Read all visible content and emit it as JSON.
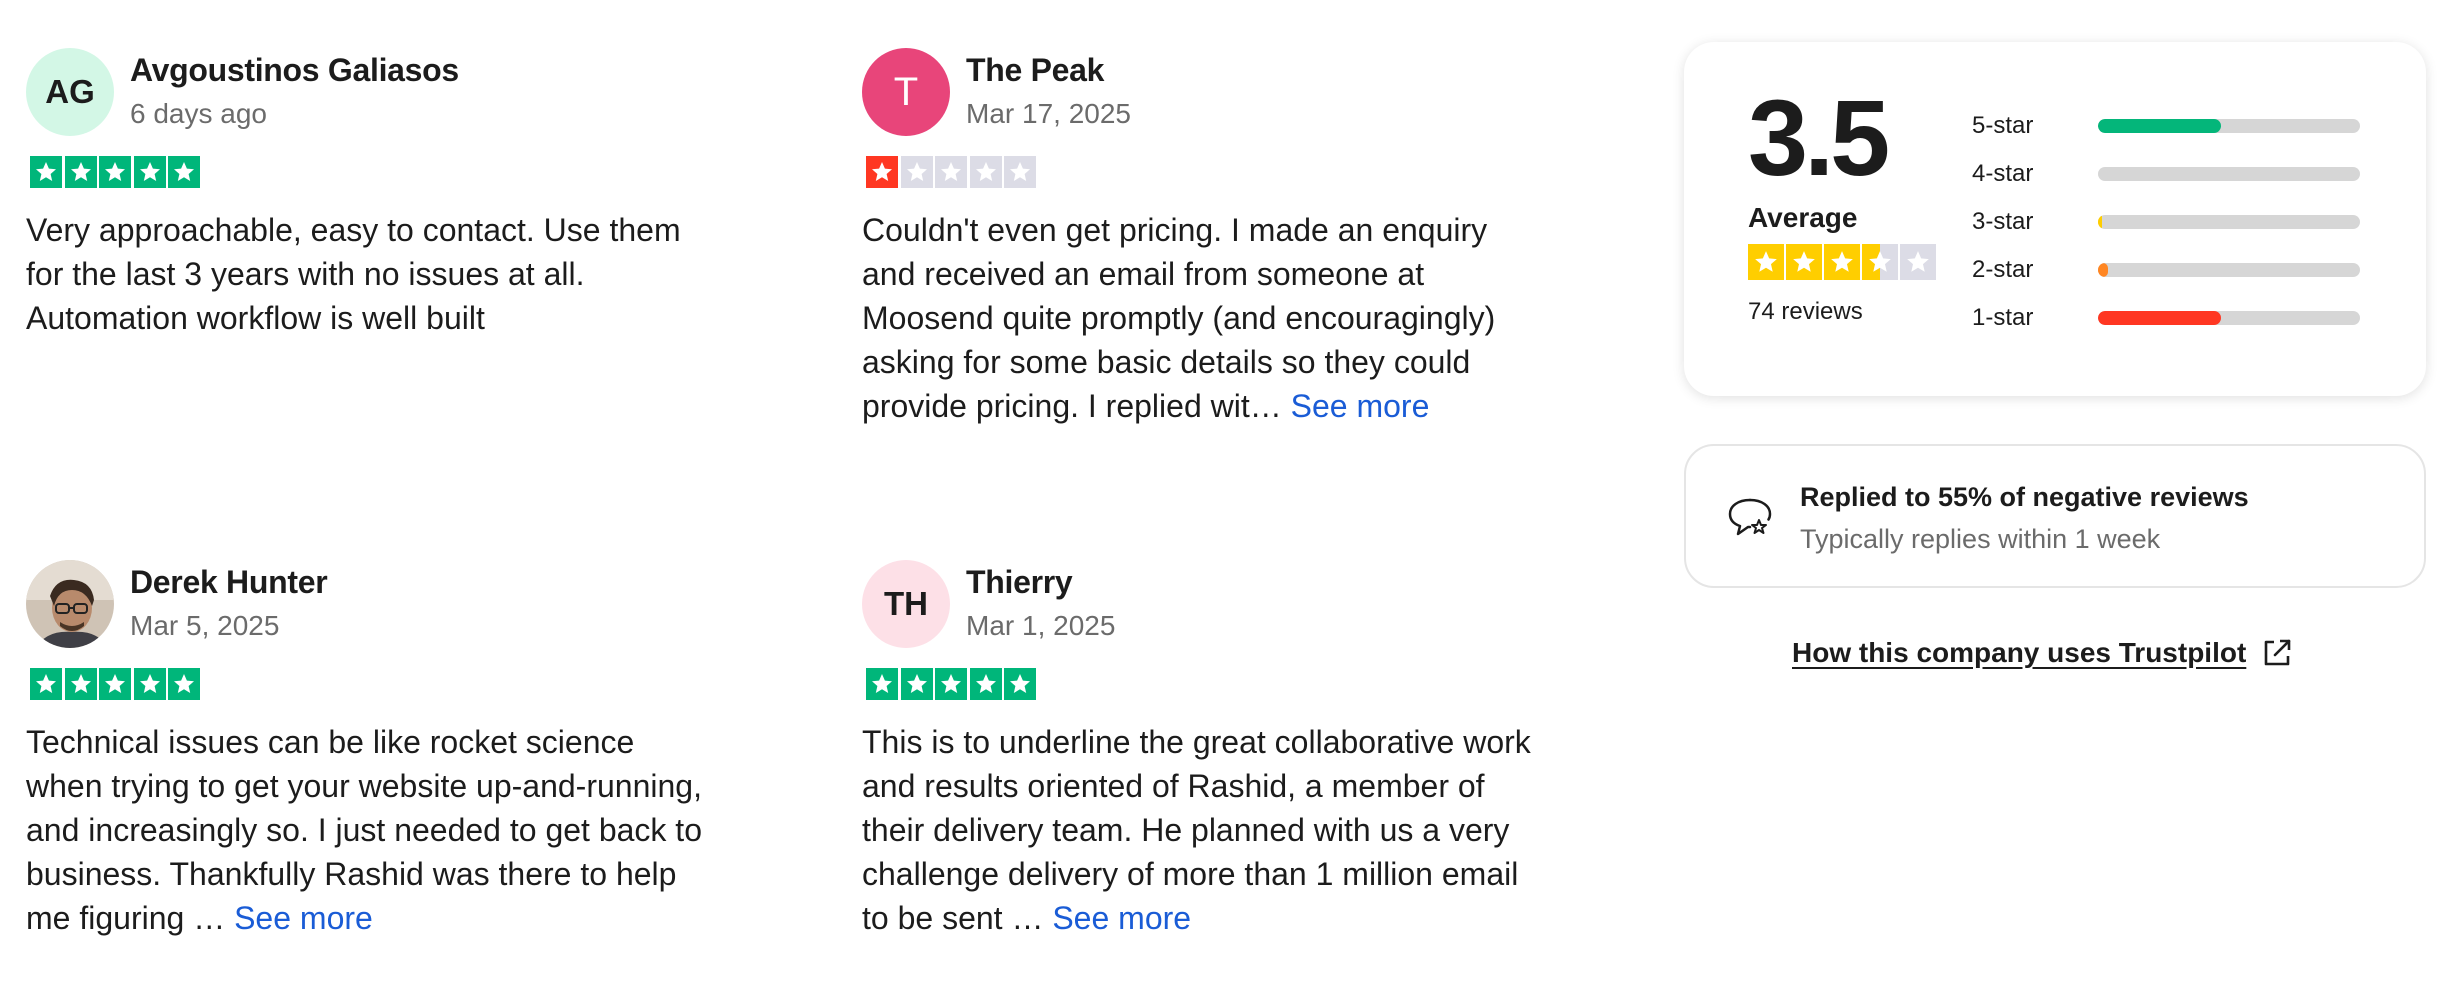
{
  "reviews": [
    {
      "initials": "AG",
      "avatar_bg": "#d3f7e6",
      "avatar_type": "initials",
      "name": "Avgoustinos Galiasos",
      "date": "6 days ago",
      "rating": 5,
      "text": "Very approachable, easy to contact. Use them for the last 3 years with no issues at all. Automation workflow is well built",
      "see_more": ""
    },
    {
      "initials": "T",
      "avatar_bg": "#e8457a",
      "avatar_type": "letter",
      "name": "The Peak",
      "date": "Mar 17, 2025",
      "rating": 1,
      "text": "Couldn't even get pricing. I made an enquiry and received an email from someone at Moosend quite promptly (and encouragingly) asking for some basic details so they could provide pricing. I replied wit…",
      "see_more": "See more"
    },
    {
      "initials": "",
      "avatar_bg": "#8a7a6a",
      "avatar_type": "photo",
      "name": "Derek Hunter",
      "date": "Mar 5, 2025",
      "rating": 5,
      "text": "Technical issues can be like rocket science when trying to get your website up-and-running, and increasingly so. I just needed to get back to business. Thankfully Rashid was there to help me figuring …",
      "see_more": "See more"
    },
    {
      "initials": "TH",
      "avatar_bg": "#fde0e7",
      "avatar_type": "initials",
      "name": "Thierry",
      "date": "Mar 1, 2025",
      "rating": 5,
      "text": "This is to underline the great collaborative work and results oriented of Rashid, a member of their delivery team. He planned with us a very challenge delivery of more than 1 million email to be sent …",
      "see_more": "See more"
    }
  ],
  "summary": {
    "score": "3.5",
    "average_label": "Average",
    "rating": 3.5,
    "review_count": "74 reviews",
    "distribution": [
      {
        "label": "5-star",
        "fraction": 0.47,
        "color": "#04b67a"
      },
      {
        "label": "4-star",
        "fraction": 0.0,
        "color": "#73cf11"
      },
      {
        "label": "3-star",
        "fraction": 0.015,
        "color": "#ffce00"
      },
      {
        "label": "2-star",
        "fraction": 0.04,
        "color": "#ff8622"
      },
      {
        "label": "1-star",
        "fraction": 0.47,
        "color": "#ff3722"
      }
    ]
  },
  "replied": {
    "title": "Replied to 55% of negative reviews",
    "subtitle": "Typically replies within 1 week"
  },
  "how_link": "How this company uses Trustpilot",
  "colors": {
    "five_star": "#00b67a",
    "one_star": "#ff3722",
    "summary_star": "#ffce00",
    "empty_star": "#dcdce6",
    "link": "#1a5cd6"
  }
}
